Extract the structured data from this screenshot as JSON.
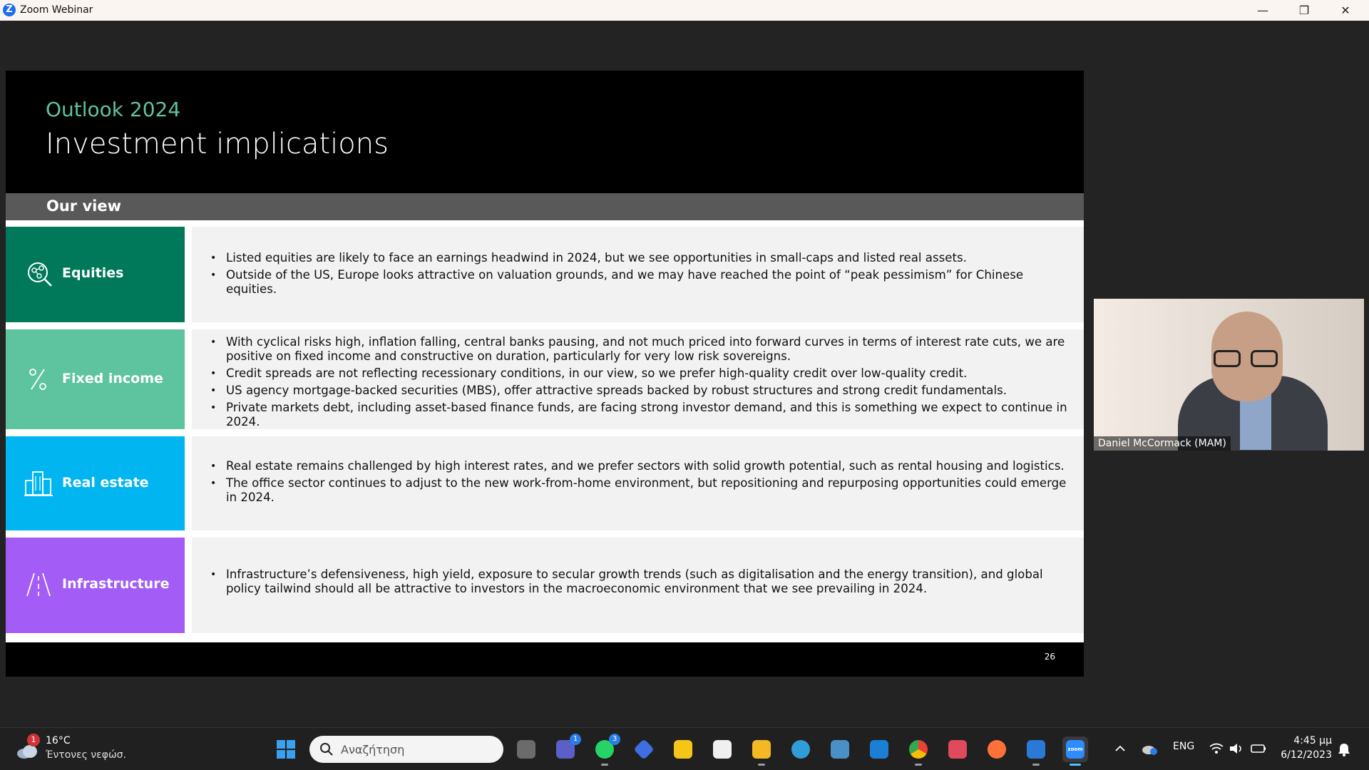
{
  "window": {
    "title": "Zoom Webinar",
    "minimize": "—",
    "restore": "❐",
    "close": "✕"
  },
  "slide": {
    "eyebrow": "Outlook 2024",
    "title": "Investment implications",
    "section": "Our view",
    "page_number": "26",
    "rows": [
      {
        "label": "Equities",
        "color": "#00785a",
        "icon": "equities-network-icon",
        "bullets": [
          "Listed equities are likely to face an earnings headwind in 2024, but we see opportunities in small-caps and listed real assets.",
          "Outside of the US, Europe looks attractive on valuation grounds, and we may have reached the point of “peak pessimism” for Chinese equities."
        ]
      },
      {
        "label": "Fixed income",
        "color": "#5ec4a0",
        "icon": "percent-icon",
        "bullets": [
          "With cyclical risks high, inflation falling, central banks pausing, and not much priced into forward curves in terms of interest rate cuts, we are positive on fixed income and constructive on duration, particularly for very low risk sovereigns.",
          "Credit spreads are not reflecting recessionary conditions, in our view, so we prefer high-quality credit over low-quality credit.",
          "US agency mortgage-backed securities (MBS), offer attractive spreads backed by robust structures and strong credit fundamentals.",
          "Private markets debt, including asset-based finance funds, are facing strong investor demand, and this is something we expect to continue in 2024."
        ]
      },
      {
        "label": "Real estate",
        "color": "#00b5f0",
        "icon": "buildings-icon",
        "bullets": [
          "Real estate remains challenged by high interest rates, and we prefer sectors with solid growth potential, such as rental housing and logistics.",
          "The office sector continues to adjust to the new work-from-home environment, but repositioning and repurposing opportunities could emerge in 2024."
        ]
      },
      {
        "label": "Infrastructure",
        "color": "#a35cf5",
        "icon": "road-icon",
        "bullets": [
          "Infrastructure’s defensiveness, high yield, exposure to secular growth trends (such as digitalisation and the energy transition), and global policy tailwind should all be attractive to investors in the macroeconomic environment that we see prevailing in 2024."
        ]
      }
    ]
  },
  "participant": {
    "name": "Daniel McCormack (MAM)"
  },
  "taskbar": {
    "weather": {
      "temp": "16°C",
      "desc": "Έντονες νεφώσ.",
      "badge": "1"
    },
    "search_placeholder": "Αναζήτηση",
    "teams_badge": "1",
    "whatsapp_badge": "3",
    "zoom_label": "zoom",
    "language": "ENG",
    "time": "4:45 μμ",
    "date": "6/12/2023"
  }
}
